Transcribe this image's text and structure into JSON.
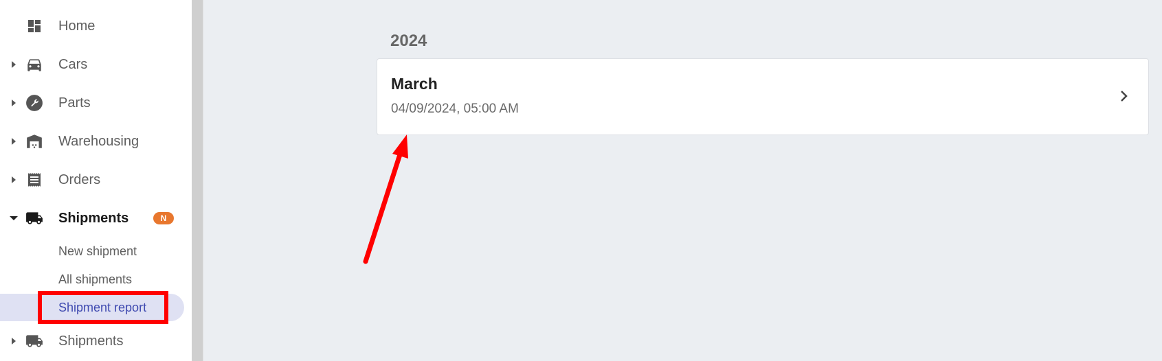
{
  "sidebar": {
    "items": [
      {
        "label": "Home",
        "icon": "dashboard-icon",
        "caret": "none"
      },
      {
        "label": "Cars",
        "icon": "car-icon",
        "caret": "right"
      },
      {
        "label": "Parts",
        "icon": "wrench-icon",
        "caret": "right"
      },
      {
        "label": "Warehousing",
        "icon": "warehouse-icon",
        "caret": "right"
      },
      {
        "label": "Orders",
        "icon": "receipt-icon",
        "caret": "right"
      },
      {
        "label": "Shipments",
        "icon": "truck-icon",
        "caret": "down",
        "badge": "N"
      }
    ],
    "sub_items": [
      {
        "label": "New shipment"
      },
      {
        "label": "All shipments"
      },
      {
        "label": "Shipment report",
        "active": true
      }
    ],
    "last_item": {
      "label": "Shipments",
      "icon": "truck-icon",
      "caret": "right"
    }
  },
  "main": {
    "year": "2024",
    "report": {
      "title": "March",
      "date": "04/09/2024, 05:00 AM"
    }
  },
  "colors": {
    "accent": "#3f4ab0",
    "badge": "#e8772e",
    "annotation": "#ff0000"
  }
}
